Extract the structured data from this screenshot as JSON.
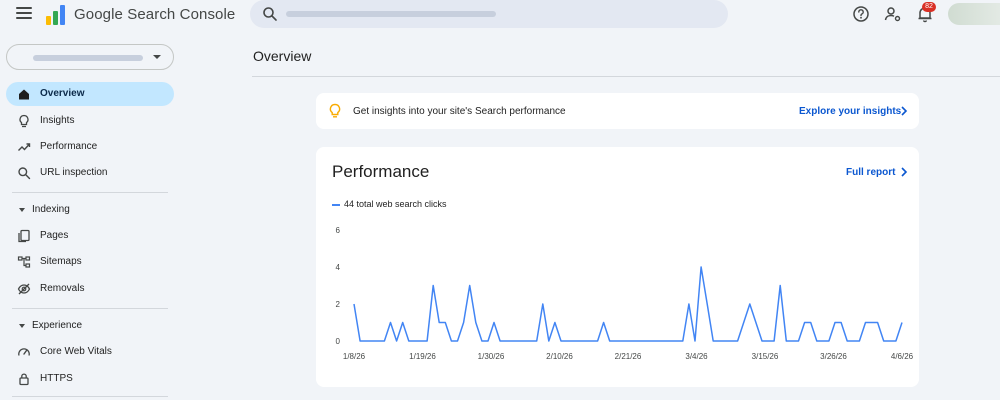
{
  "header": {
    "brand": "Google Search Console",
    "search_value": "",
    "notification_count": "82"
  },
  "icons": {
    "menu": "hamburger-menu-icon",
    "logo": "search-console-logo",
    "search": "search-icon",
    "help": "help-circle-icon",
    "account_settings": "account-settings-icon",
    "notifications": "bell-icon"
  },
  "sidebar": {
    "items": [
      {
        "label": "Overview",
        "icon": "home-icon",
        "active": true
      },
      {
        "label": "Insights",
        "icon": "lightbulb-icon",
        "active": false
      },
      {
        "label": "Performance",
        "icon": "trending-up-icon",
        "active": false
      },
      {
        "label": "URL inspection",
        "icon": "search-icon",
        "active": false
      }
    ],
    "sections": [
      {
        "label": "Indexing",
        "items": [
          {
            "label": "Pages",
            "icon": "pages-icon"
          },
          {
            "label": "Sitemaps",
            "icon": "sitemap-icon"
          },
          {
            "label": "Removals",
            "icon": "eye-off-icon"
          }
        ]
      },
      {
        "label": "Experience",
        "items": [
          {
            "label": "Core Web Vitals",
            "icon": "speed-gauge-icon"
          },
          {
            "label": "HTTPS",
            "icon": "lock-icon"
          }
        ]
      }
    ]
  },
  "main": {
    "title": "Overview",
    "insight_banner": {
      "text": "Get insights into your site's Search performance",
      "link": "Explore your insights"
    },
    "performance": {
      "title": "Performance",
      "link": "Full report",
      "legend": "44 total web search clicks"
    }
  },
  "colors": {
    "accent": "#0b57d0",
    "active_nav": "#c2e7ff",
    "series": "#4285f4",
    "background": "#f1f4f8"
  },
  "chart_data": {
    "type": "line",
    "title": "",
    "xlabel": "",
    "ylabel": "",
    "ylim": [
      0,
      6
    ],
    "y_ticks": [
      0,
      2,
      4,
      6
    ],
    "x_ticks": [
      "1/8/26",
      "1/19/26",
      "1/30/26",
      "2/10/26",
      "2/21/26",
      "3/4/26",
      "3/15/26",
      "3/26/26",
      "4/6/26"
    ],
    "grid": false,
    "series": [
      {
        "name": "44 total web search clicks",
        "values": [
          2,
          0,
          0,
          0,
          0,
          0,
          1,
          0,
          1,
          0,
          0,
          0,
          0,
          3,
          1,
          1,
          0,
          0,
          1,
          3,
          1,
          0,
          0,
          1,
          0,
          0,
          0,
          0,
          0,
          0,
          0,
          2,
          0,
          1,
          0,
          0,
          0,
          0,
          0,
          0,
          0,
          1,
          0,
          0,
          0,
          0,
          0,
          0,
          0,
          0,
          0,
          0,
          0,
          0,
          0,
          2,
          0,
          4,
          2,
          0,
          0,
          0,
          0,
          0,
          1,
          2,
          1,
          0,
          0,
          0,
          3,
          0,
          0,
          0,
          1,
          1,
          0,
          0,
          0,
          1,
          1,
          0,
          0,
          0,
          1,
          1,
          1,
          0,
          0,
          0,
          1
        ]
      }
    ]
  }
}
